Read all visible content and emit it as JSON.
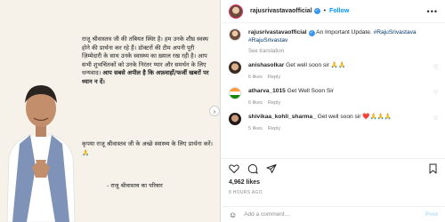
{
  "post": {
    "notice_line1": "राजू श्रीवास्तव जी की तबियत स्थिर है। हम उनके शीघ्र स्वस्थ होने की प्रार्थना कर रहे हैं। डॉक्टरों की टीम अपनी पूरी ज़िम्मेदारी के साथ उनके स्वास्थ्य का ख़्याल रख रही है। आप सभी शुभचिंतकों को उनके निरंतर प्यार और समर्थन के लिए धन्यवाद। ",
    "notice_bold": "आप सबसे अपील है कि अफ़वाहों/फर्जी खबरों पर ध्यान न दें।",
    "prayer": "कृपया राजू श्रीवास्तव जी के अच्छे स्वास्थ्य के लिए प्रार्थना करें।🙏",
    "family_sign": "- राजू श्रीवास्तव का परिवार"
  },
  "header": {
    "handle": "rajusrivastavaofficial",
    "dot": "•",
    "follow": "Follow",
    "more": "•••"
  },
  "caption": {
    "handle": "rajusrivastavaofficial",
    "text": " An Important Update. ",
    "tags": "#RajuSrivastava #RajuSrivastav",
    "see_translation": "See translation"
  },
  "comments": [
    {
      "user": "anishasolkar",
      "text": " Get well soon sir 🙏🙏",
      "time": "",
      "likes": "6 likes",
      "reply": "Reply"
    },
    {
      "user": "atharva_1015",
      "text": " Get Well Soon Sir",
      "time": "",
      "likes": "6 likes",
      "reply": "Reply"
    },
    {
      "user": "shivikaa_kohli_sharma_",
      "text": " Get well soon sir ❤️🙏🙏🙏",
      "time": "",
      "likes": "5 likes",
      "reply": "Reply"
    }
  ],
  "stats": {
    "likes": "4,962 likes",
    "ago": "8 HOURS AGO"
  },
  "comment_box": {
    "placeholder": "Add a comment...",
    "post": "Post"
  }
}
